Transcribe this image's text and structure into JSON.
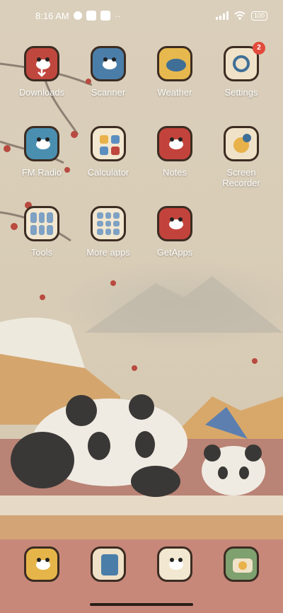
{
  "status_bar": {
    "time": "8:16 AM",
    "battery": "100",
    "overflow": "··"
  },
  "apps": [
    {
      "name": "Downloads",
      "color": "#c0473e",
      "icon": "download-icon"
    },
    {
      "name": "Scanner",
      "color": "#4a7ea8",
      "icon": "scanner-icon"
    },
    {
      "name": "Weather",
      "color": "#e7b84e",
      "icon": "weather-icon"
    },
    {
      "name": "Settings",
      "color": "#efe2c8",
      "icon": "settings-icon",
      "badge": "2"
    },
    {
      "name": "FM Radio",
      "color": "#4a8fb0",
      "icon": "radio-icon"
    },
    {
      "name": "Calculator",
      "color": "#f2e7d0",
      "icon": "calculator-icon"
    },
    {
      "name": "Notes",
      "color": "#c2433b",
      "icon": "notes-icon"
    },
    {
      "name": "Screen Recorder",
      "color": "#efe2c8",
      "icon": "screen-recorder-icon"
    },
    {
      "name": "Tools",
      "color": "#f1e6cf",
      "icon": "folder-icon"
    },
    {
      "name": "More apps",
      "color": "#f1e6cf",
      "icon": "folder-icon"
    },
    {
      "name": "GetApps",
      "color": "#c2433b",
      "icon": "getapps-icon"
    }
  ],
  "dock": [
    {
      "icon": "phone-icon",
      "color": "#e6b54a"
    },
    {
      "icon": "contacts-icon",
      "color": "#efe2c8"
    },
    {
      "icon": "messages-icon",
      "color": "#f2e7d0"
    },
    {
      "icon": "camera-icon",
      "color": "#7fa06f"
    }
  ]
}
